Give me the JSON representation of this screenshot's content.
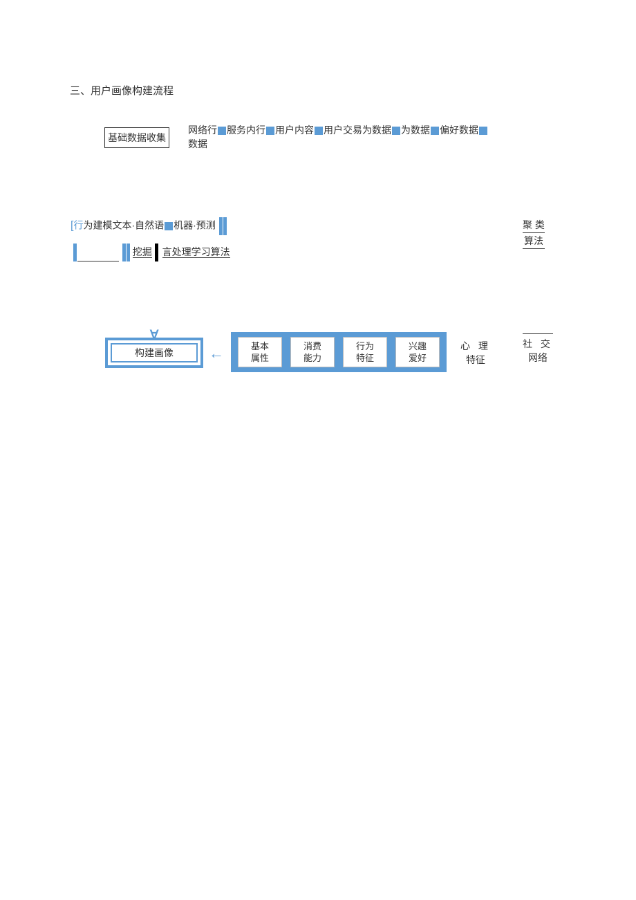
{
  "title": "三、用户画像构建流程",
  "row1": {
    "box": "基础数据收集",
    "text_line1_a": "网络行",
    "text_line1_b": "服务内行",
    "text_line1_c": "用户内容",
    "text_line1_d": "用户交易为数据",
    "text_line1_e": "为数据",
    "text_line1_f": "偏好数据",
    "text_line2": "数据"
  },
  "row2": {
    "a": "为建模文本",
    "b": "自然语",
    "c": "机器",
    "d": "预测",
    "line2_a": "挖掘",
    "line2_b": "言处理学习算法",
    "cluster1": "聚 类",
    "cluster2": "算法"
  },
  "row3": {
    "build": "构建画像",
    "tags": [
      {
        "l1": "基本",
        "l2": "属性"
      },
      {
        "l1": "消费",
        "l2": "能力"
      },
      {
        "l1": "行为",
        "l2": "特征"
      },
      {
        "l1": "兴趣",
        "l2": "爱好"
      }
    ],
    "psych1": "心 理",
    "psych2": "特征",
    "social1": "社 交",
    "social2": "网络"
  }
}
